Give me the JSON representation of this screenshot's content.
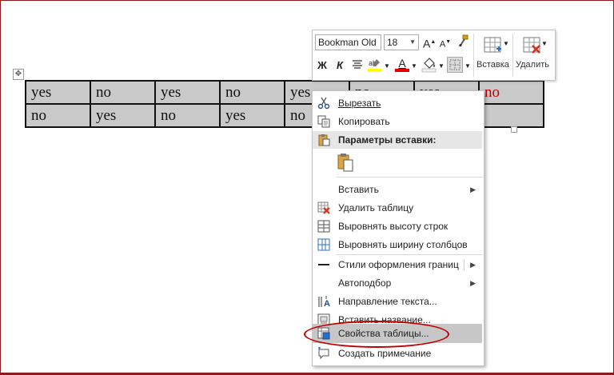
{
  "table": {
    "rows": [
      [
        "yes",
        "no",
        "yes",
        "no",
        "yes",
        "no",
        "yes",
        "no"
      ],
      [
        "no",
        "yes",
        "no",
        "yes",
        "no",
        "",
        "",
        ""
      ]
    ],
    "highlight_color": "#c00000"
  },
  "mini_toolbar": {
    "font_name": "Bookman Old",
    "font_size": "18",
    "bold": "Ж",
    "italic": "К",
    "grow_font": "A",
    "shrink_font": "A",
    "font_color_letter": "A",
    "insert_label": "Вставка",
    "delete_label": "Удалить"
  },
  "context_menu": {
    "items": [
      {
        "label": "Вырезать",
        "icon": "scissors-icon"
      },
      {
        "label": "Копировать",
        "icon": "copy-icon"
      },
      {
        "label": "Параметры вставки:",
        "icon": "paste-icon"
      },
      {
        "label": "",
        "icon": "paste-keep-formatting-icon"
      },
      {
        "label": "Вставить",
        "icon": ""
      },
      {
        "label": "Удалить таблицу",
        "icon": "delete-table-icon"
      },
      {
        "label": "Выровнять высоту строк",
        "icon": "distribute-rows-icon"
      },
      {
        "label": "Выровнять ширину столбцов",
        "icon": "distribute-columns-icon"
      },
      {
        "label": "Стили оформления границ",
        "icon": "border-style-icon"
      },
      {
        "label": "Автоподбор",
        "icon": ""
      },
      {
        "label": "Направление текста...",
        "icon": "text-direction-icon"
      },
      {
        "label": "Вставить название...",
        "icon": "insert-caption-icon"
      },
      {
        "label": "Свойства таблицы...",
        "icon": "table-properties-icon"
      },
      {
        "label": "Создать примечание",
        "icon": "new-comment-icon"
      }
    ]
  },
  "colors": {
    "accent_red": "#c00000",
    "cell_fill": "#c9c9c9",
    "menu_highlight": "#c7c7c7"
  }
}
